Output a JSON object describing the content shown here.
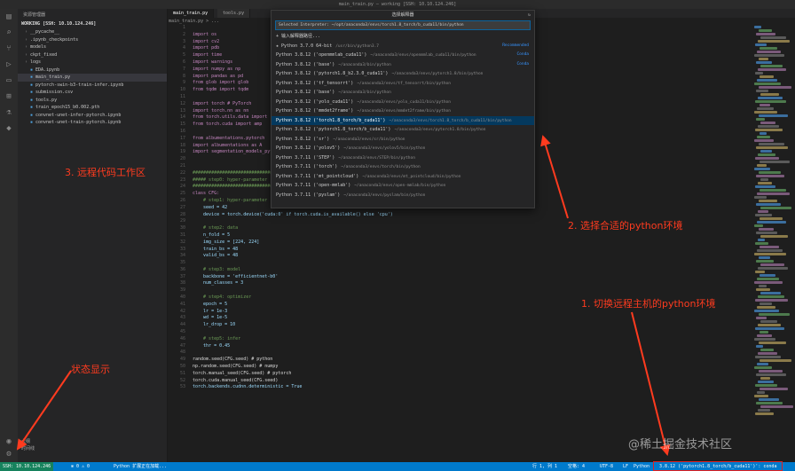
{
  "window": {
    "title": "main_train.py — working [SSH: 10.10.124.246]"
  },
  "activity_bar": {
    "icons": [
      "files-icon",
      "search-icon",
      "source-control-icon",
      "run-debug-icon",
      "remote-explorer-icon",
      "extensions-icon",
      "testing-icon",
      "python-icon"
    ],
    "bottom_icons": [
      "account-icon",
      "settings-gear-icon"
    ]
  },
  "sidebar": {
    "header": "资源管理器",
    "root": "WORKING [SSH: 10.10.124.246]",
    "items": [
      {
        "label": "__pycache__",
        "kind": "folder"
      },
      {
        "label": ".ipynb_checkpoints",
        "kind": "folder"
      },
      {
        "label": "models",
        "kind": "folder"
      },
      {
        "label": "ckpt_fixed",
        "kind": "folder"
      },
      {
        "label": "logs",
        "kind": "folder"
      },
      {
        "label": "EDA.ipynb",
        "kind": "file"
      },
      {
        "label": "main_train.py",
        "kind": "file",
        "selected": true
      },
      {
        "label": "pytorch-swin-b3-train-infer.ipynb",
        "kind": "file"
      },
      {
        "label": "submission.csv",
        "kind": "file"
      },
      {
        "label": "tools.py",
        "kind": "file"
      },
      {
        "label": "train_epoch15_b0.002.pth",
        "kind": "file"
      },
      {
        "label": "convnet-unet-infer-pytorch.ipynb",
        "kind": "file"
      },
      {
        "label": "convnet-unet-train-pytorch.ipynb",
        "kind": "file"
      }
    ],
    "outline": "大纲",
    "timeline": "时间线"
  },
  "tabs": [
    {
      "label": "main_train.py",
      "active": true
    },
    {
      "label": "tools.py",
      "active": false
    }
  ],
  "breadcrumb": "main_train.py > ...",
  "editor": {
    "lines": [
      {
        "n": "1",
        "code": ""
      },
      {
        "n": "2",
        "code": "import os"
      },
      {
        "n": "3",
        "code": "import cv2"
      },
      {
        "n": "4",
        "code": "import pdb"
      },
      {
        "n": "5",
        "code": "import time"
      },
      {
        "n": "6",
        "code": "import warnings"
      },
      {
        "n": "7",
        "code": "import numpy as np"
      },
      {
        "n": "8",
        "code": "import pandas as pd"
      },
      {
        "n": "9",
        "code": "from glob import glob"
      },
      {
        "n": "10",
        "code": "from tqdm import tqdm"
      },
      {
        "n": "11",
        "code": ""
      },
      {
        "n": "12",
        "code": "import torch # PyTorch"
      },
      {
        "n": "13",
        "code": "import torch.nn as nn"
      },
      {
        "n": "14",
        "code": "from torch.utils.data import"
      },
      {
        "n": "15",
        "code": "from torch.cuda import amp"
      },
      {
        "n": "16",
        "code": ""
      },
      {
        "n": "17",
        "code": "from albumentations.pytorch"
      },
      {
        "n": "18",
        "code": "import albumentations as A"
      },
      {
        "n": "19",
        "code": "import segmentation_models_pytorch as smp"
      },
      {
        "n": "20",
        "code": ""
      },
      {
        "n": "21",
        "code": ""
      },
      {
        "n": "22",
        "code": "###############################################################"
      },
      {
        "n": "23",
        "code": "##### step0: hyper-parameter"
      },
      {
        "n": "24",
        "code": "###############################################################"
      },
      {
        "n": "25",
        "code": "class CFG:"
      },
      {
        "n": "26",
        "code": "    # step1: hyper-parameter"
      },
      {
        "n": "27",
        "code": "    seed = 42"
      },
      {
        "n": "28",
        "code": "    device = torch.device('cuda:0' if torch.cuda.is_available() else 'cpu')"
      },
      {
        "n": "29",
        "code": ""
      },
      {
        "n": "30",
        "code": "    # step2: data"
      },
      {
        "n": "31",
        "code": "    n_fold = 5"
      },
      {
        "n": "32",
        "code": "    img_size = [224, 224]"
      },
      {
        "n": "33",
        "code": "    train_bs = 48"
      },
      {
        "n": "34",
        "code": "    valid_bs = 48"
      },
      {
        "n": "35",
        "code": ""
      },
      {
        "n": "36",
        "code": "    # step3: model"
      },
      {
        "n": "37",
        "code": "    backbone = 'efficientnet-b0'"
      },
      {
        "n": "38",
        "code": "    num_classes = 3"
      },
      {
        "n": "39",
        "code": ""
      },
      {
        "n": "40",
        "code": "    # step4: optimizer"
      },
      {
        "n": "41",
        "code": "    epoch = 5"
      },
      {
        "n": "42",
        "code": "    lr = 1e-3"
      },
      {
        "n": "43",
        "code": "    wd = 1e-5"
      },
      {
        "n": "44",
        "code": "    lr_drop = 10"
      },
      {
        "n": "45",
        "code": ""
      },
      {
        "n": "46",
        "code": "    # step5: infer"
      },
      {
        "n": "47",
        "code": "    thr = 0.45"
      },
      {
        "n": "48",
        "code": ""
      },
      {
        "n": "49",
        "code": "random.seed(CFG.seed) # python"
      },
      {
        "n": "50",
        "code": "np.random.seed(CFG.seed) # numpy"
      },
      {
        "n": "51",
        "code": "torch.manual_seed(CFG.seed) # pytorch"
      },
      {
        "n": "52",
        "code": "torch.cuda.manual_seed(CFG.seed)"
      },
      {
        "n": "53",
        "code": "torch.backends.cudnn.deterministic = True"
      }
    ]
  },
  "palette": {
    "title": "选择解释器",
    "input": "Selected Interpreter: ~/opt/anaconda3/envs/torch1.8_torch/b_cuda11/bin/python",
    "items": [
      {
        "label": "+ 输入解释器路径...",
        "path": "",
        "tag": ""
      },
      {
        "label": "★ Python 3.7.0 64-bit",
        "path": "/usr/bin/python3.7",
        "tag": "Recommended"
      },
      {
        "label": "Python 3.8.12 ('openmmlab_cuda11')",
        "path": "~/anaconda3/envs/openmmlab_cuda11/bin/python",
        "tag": "Conda"
      },
      {
        "label": "Python 3.8.12 ('base')",
        "path": "~/anaconda3/bin/python",
        "tag": "Conda"
      },
      {
        "label": "Python 3.8.12 ('pytorch1.8_b2.3.0_cuda11')",
        "path": "~/anaconda3/envs/pytorch1.8/bin/python",
        "tag": ""
      },
      {
        "label": "Python 3.8.12 ('tf_tensorrt')",
        "path": "~/anaconda3/envs/tf_tensorrt/bin/python",
        "tag": ""
      },
      {
        "label": "Python 3.8.12 ('base')",
        "path": "~/anaconda3/bin/python",
        "tag": ""
      },
      {
        "label": "Python 3.8.12 ('yolo_cuda11')",
        "path": "~/anaconda3/envs/yolo_cuda11/bin/python",
        "tag": ""
      },
      {
        "label": "Python 3.8.12 ('mmdet2frame')",
        "path": "~/anaconda3/envs/mmdet2frame/bin/python",
        "tag": ""
      },
      {
        "label": "Python 3.8.12 ('torch1.8_torch/b_cuda11')",
        "path": "~/anaconda3/envs/torch1.8_torch/b_cuda11/bin/python",
        "tag": "",
        "selected": true
      },
      {
        "label": "Python 3.8.12 ('pytorch1.8_torch/b_cuda11')",
        "path": "~/anaconda3/envs/pytorch1.8/bin/python",
        "tag": ""
      },
      {
        "label": "Python 3.8.12 ('sr')",
        "path": "~/anaconda3/envs/sr/bin/python",
        "tag": ""
      },
      {
        "label": "Python 3.8.12 ('yolov5')",
        "path": "~/anaconda3/envs/yolov5/bin/python",
        "tag": ""
      },
      {
        "label": "Python 3.7.11 ('STEP')",
        "path": "~/anaconda3/envs/STEP/bin/python",
        "tag": ""
      },
      {
        "label": "Python 3.7.11 ('torch')",
        "path": "~/anaconda3/envs/torch/bin/python",
        "tag": ""
      },
      {
        "label": "Python 3.7.11 ('mt_pointcloud')",
        "path": "~/anaconda3/envs/mt_pointcloud/bin/python",
        "tag": ""
      },
      {
        "label": "Python 3.7.11 ('open-mmlab')",
        "path": "~/anaconda3/envs/open-mmlab/bin/python",
        "tag": ""
      },
      {
        "label": "Python 3.7.11 ('pyslam')",
        "path": "~/anaconda3/envs/pyslam/bin/python",
        "tag": ""
      }
    ]
  },
  "statusbar": {
    "remote": "SSH: 10.10.124.246",
    "errors": "⊗ 0 ⚠ 0",
    "left_msg": "Python 扩展正在加载...",
    "position": "行 1, 列 1",
    "spaces": "空格: 4",
    "encoding": "UTF-8",
    "eol": "LF",
    "language": "Python",
    "interpreter": "3.8.12 ('pytorch1.8_torch/b_cuda11')': conda"
  },
  "annotations": {
    "a1": "1. 切换远程主机的python环境",
    "a2": "2. 选择合适的python环境",
    "a3": "3. 远程代码工作区",
    "a4": "状态显示"
  },
  "watermark": "@稀土掘金技术社区",
  "colors": {
    "accent": "#007acc",
    "annotation": "#ff3b1f",
    "remote": "#16825d",
    "selection": "#04395e"
  }
}
